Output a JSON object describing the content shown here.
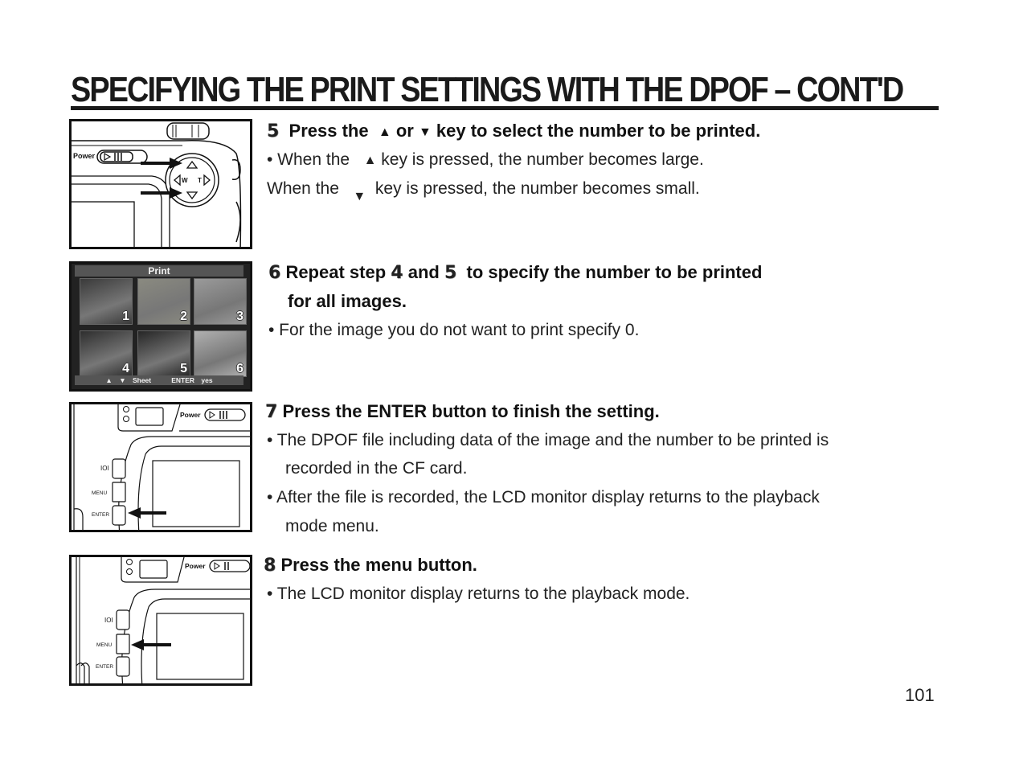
{
  "page": {
    "title": "SPECIFYING THE PRINT SETTINGS WITH THE DPOF – CONT'D",
    "page_number": "101"
  },
  "steps": [
    {
      "number": "5",
      "heading_parts": [
        "Press the",
        "▲",
        "or",
        "▼",
        "key to select the number to be printed."
      ],
      "bullets": [
        {
          "parts": [
            "•  When the",
            "▲",
            "key is pressed, the number becomes large."
          ]
        },
        {
          "parts": [
            "When the",
            "▼",
            "key is pressed, the number becomes small."
          ]
        }
      ],
      "figure": {
        "labels": {
          "power": "Power",
          "wide": "W",
          "tele": "T"
        },
        "icons": [
          "power-switch",
          "directional-pad",
          "arrow-right"
        ]
      }
    },
    {
      "number": "6",
      "heading_parts": [
        "Repeat step",
        "4",
        "and",
        "5",
        "to specify the number to be printed"
      ],
      "heading_line2": "for all images.",
      "bullets": [
        {
          "parts": [
            "• For the image you do not want to print specify 0."
          ]
        }
      ],
      "figure": {
        "screen_title": "Print",
        "thumbnails": [
          {
            "label": "1",
            "tone": "#3a3a3a"
          },
          {
            "label": "2",
            "tone": "#8a8a80"
          },
          {
            "label": "3",
            "tone": "#9a9a9a"
          },
          {
            "label": "4",
            "tone": "#2e2e2e"
          },
          {
            "label": "5",
            "tone": "#262626"
          },
          {
            "label": "6",
            "tone": "#b0b0b0"
          }
        ],
        "footer_nav": "▲ ▼ Sheet",
        "footer_enter": "ENTER yes"
      }
    },
    {
      "number": "7",
      "heading_parts": [
        "Press the ENTER button to finish the setting."
      ],
      "bullets": [
        {
          "parts": [
            "• The DPOF file including data of the image and the number to be printed is"
          ]
        },
        {
          "parts": [
            "recorded in the CF card."
          ]
        },
        {
          "parts": [
            "•  After the file is recorded, the LCD monitor display returns to the playback"
          ]
        },
        {
          "parts": [
            "mode menu."
          ]
        }
      ],
      "figure": {
        "labels": {
          "power": "Power",
          "display": "IOI",
          "menu": "MENU",
          "enter": "ENTER"
        },
        "highlighted_button": "ENTER"
      }
    },
    {
      "number": "8",
      "heading_parts": [
        "Press the menu button."
      ],
      "bullets": [
        {
          "parts": [
            "•  The LCD monitor display returns to the playback mode."
          ]
        }
      ],
      "figure": {
        "labels": {
          "power": "Power",
          "display": "IOI",
          "menu": "MENU",
          "enter": "ENTER"
        },
        "highlighted_button": "MENU"
      }
    }
  ]
}
